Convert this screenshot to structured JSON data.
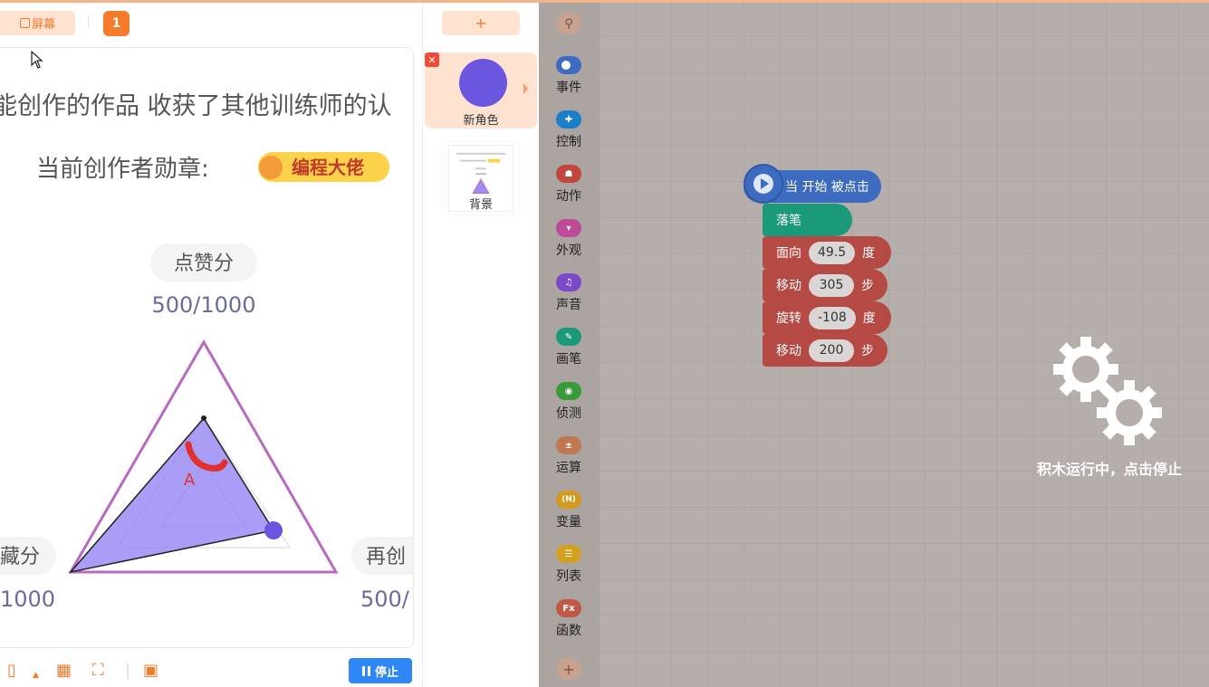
{
  "stage_toolbar": {
    "screen_label": "屏幕",
    "page_number": "1"
  },
  "stage": {
    "text_line1": "能创作的作品 收获了其他训练师的认",
    "badge_prefix": "当前创作者勋章:",
    "badge_label": "编程大佬",
    "radar": {
      "top_label": "点赞分",
      "top_value": "500/1000",
      "left_label": "藏分",
      "left_value": "1000",
      "right_label": "再创",
      "right_value": "500/",
      "center_letter": "A"
    }
  },
  "stage_bottom": {
    "stop_label": "停止"
  },
  "sprites": {
    "add_label": "+",
    "items": [
      {
        "name": "新角色",
        "color": "#6b56e0"
      }
    ],
    "background": {
      "name": "背景"
    }
  },
  "palette": {
    "categories": [
      {
        "label": "事件",
        "color": "#3c6bc0",
        "icon": "toggle-icon"
      },
      {
        "label": "控制",
        "color": "#1a7ec8",
        "icon": "gamepad-icon"
      },
      {
        "label": "动作",
        "color": "#c0463e",
        "icon": "ghost-icon"
      },
      {
        "label": "外观",
        "color": "#c04a9a",
        "icon": "shirt-icon"
      },
      {
        "label": "声音",
        "color": "#7a4ac8",
        "icon": "music-icon"
      },
      {
        "label": "画笔",
        "color": "#1a9a78",
        "icon": "pen-icon"
      },
      {
        "label": "侦测",
        "color": "#3a9a3a",
        "icon": "target-icon"
      },
      {
        "label": "运算",
        "color": "#c07850",
        "icon": "operator-icon"
      },
      {
        "label": "变量",
        "color": "#d49a20",
        "icon": "variable-icon"
      },
      {
        "label": "列表",
        "color": "#d4a020",
        "icon": "list-icon"
      },
      {
        "label": "函数",
        "color": "#c05a48",
        "icon": "function-icon"
      }
    ],
    "variable_glyph": "(N)",
    "function_glyph": "Fx"
  },
  "script": {
    "hat": "当 开始 被点击",
    "blocks": [
      {
        "label": "落笔",
        "color": "#1a9a78"
      },
      {
        "label": "面向",
        "value": "49.5",
        "unit": "度",
        "color": "#c0463e"
      },
      {
        "label": "移动",
        "value": "305",
        "unit": "步",
        "color": "#c0463e"
      },
      {
        "label": "旋转",
        "value": "-108",
        "unit": "度",
        "color": "#c0463e"
      },
      {
        "label": "移动",
        "value": "200",
        "unit": "步",
        "color": "#c0463e"
      }
    ]
  },
  "overlay": {
    "running_text": "积木运行中，点击停止"
  }
}
